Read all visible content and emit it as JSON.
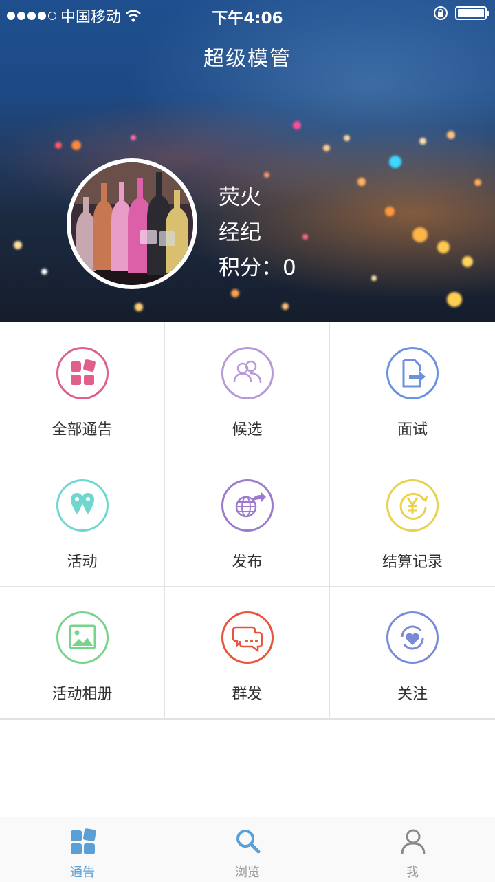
{
  "status_bar": {
    "carrier": "中国移动",
    "time": "下午4:06",
    "signal_dots": 5,
    "signal_filled": 4,
    "battery_level": 0.95
  },
  "header": {
    "title": "超级模管",
    "user": {
      "name": "荧火",
      "role": "经纪",
      "points_label": "积分：",
      "points_value": "0"
    }
  },
  "menu": [
    {
      "label": "全部通告",
      "icon": "apps-icon",
      "color": "#e0608a"
    },
    {
      "label": "候选",
      "icon": "users-icon",
      "color": "#b89ad8"
    },
    {
      "label": "面试",
      "icon": "doc-export-icon",
      "color": "#6a92e0"
    },
    {
      "label": "活动",
      "icon": "location-pins-icon",
      "color": "#6ed8d0"
    },
    {
      "label": "发布",
      "icon": "globe-share-icon",
      "color": "#9c7ad0"
    },
    {
      "label": "结算记录",
      "icon": "yen-coin-icon",
      "color": "#e8d24a"
    },
    {
      "label": "活动相册",
      "icon": "picture-icon",
      "color": "#78d48a"
    },
    {
      "label": "群发",
      "icon": "chat-bubbles-icon",
      "color": "#e8543c"
    },
    {
      "label": "关注",
      "icon": "heart-circle-icon",
      "color": "#7a8ad8"
    }
  ],
  "tabbar": {
    "tabs": [
      {
        "label": "通告",
        "icon": "grid-icon",
        "active": true
      },
      {
        "label": "浏览",
        "icon": "search-icon",
        "active": false
      },
      {
        "label": "我",
        "icon": "user-icon",
        "active": false
      }
    ],
    "active_color": "#5aa0d6",
    "inactive_color": "#9a9a9a"
  }
}
